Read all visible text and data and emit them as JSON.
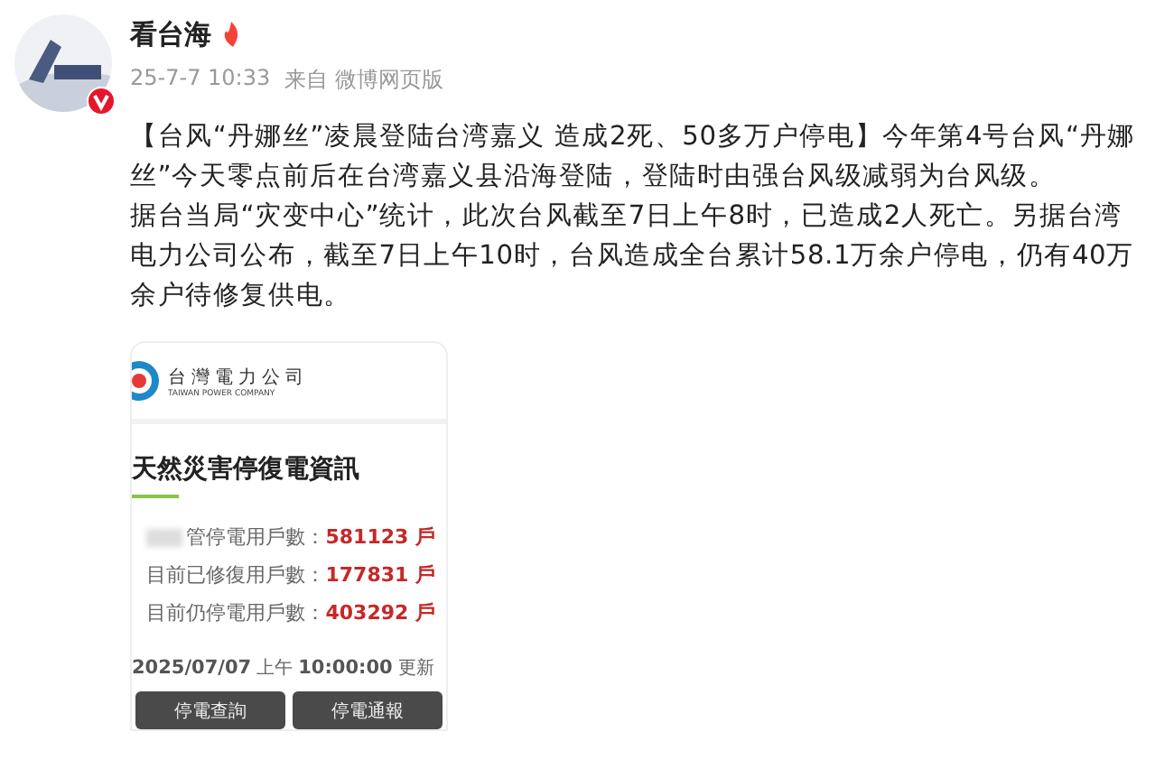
{
  "post": {
    "author": "看台海",
    "time": "25-7-7 10:33",
    "source": "来自 微博网页版",
    "paragraphs": [
      "【台风“丹娜丝”凌晨登陆台湾嘉义 造成2死、50多万户停电】今年第4号台风“丹娜丝”今天零点前后在台湾嘉义县沿海登陆，登陆时由强台风级减弱为台风级。",
      "据台当局“灾变中心”统计，此次台风截至7日上午8时，已造成2人死亡。另据台湾电力公司公布，截至7日上午10时，台风造成全台累计58.1万余户停电，仍有40万余户待修复供电。"
    ]
  },
  "card": {
    "company": "台灣電力公司",
    "company_en": "TAIWAN POWER COMPANY",
    "title": "天然災害停復電資訊",
    "rows": [
      {
        "label": "管停電用戶數：",
        "value": "581123 戶",
        "blurred": true
      },
      {
        "label": "目前已修復用戶數：",
        "value": "177831 戶",
        "blurred": false
      },
      {
        "label": "目前仍停電用戶數：",
        "value": "403292 戶",
        "blurred": false
      }
    ],
    "date": "2025/07/07",
    "ampm": "上午",
    "clock": "10:00:00",
    "updated": "更新",
    "buttons": [
      "停電查詢",
      "停電通報"
    ]
  }
}
